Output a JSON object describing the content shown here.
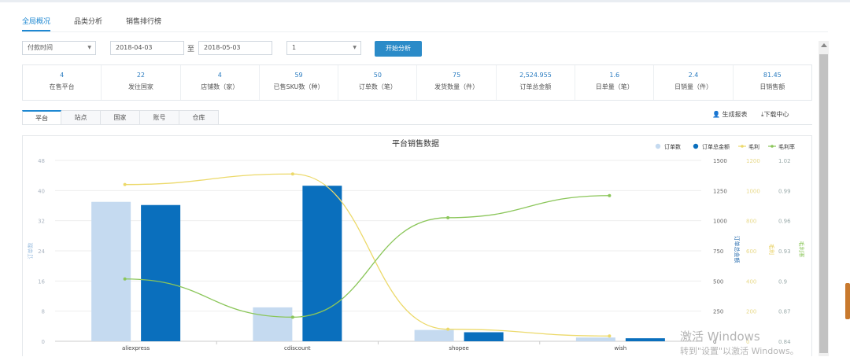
{
  "top_tabs": [
    "全局概况",
    "品类分析",
    "销售排行榜"
  ],
  "filters": {
    "time_type": "付款时间",
    "date_from": "2018-04-03",
    "to_label": "至",
    "date_to": "2018-05-03",
    "select_value": "1",
    "start_button": "开始分析"
  },
  "stats": [
    {
      "value": "4",
      "label": "在售平台"
    },
    {
      "value": "22",
      "label": "发往国家"
    },
    {
      "value": "4",
      "label": "店铺数（家）"
    },
    {
      "value": "59",
      "label": "已售SKU数（种）"
    },
    {
      "value": "50",
      "label": "订单数（笔）"
    },
    {
      "value": "75",
      "label": "发货数量（件）"
    },
    {
      "value": "2,524.955",
      "label": "订单总金额"
    },
    {
      "value": "1.6",
      "label": "日单量（笔）"
    },
    {
      "value": "2.4",
      "label": "日销量（件）"
    },
    {
      "value": "81.45",
      "label": "日销售额"
    }
  ],
  "sub_tabs": [
    "平台",
    "站点",
    "国家",
    "账号",
    "仓库"
  ],
  "actions": {
    "report": "生成报表",
    "download": "下载中心"
  },
  "colors": {
    "accent": "#1e88d2",
    "button": "#2b8bc8",
    "orders": "#c5daf0",
    "amount": "#0a6fbd",
    "profit": "#ecd96a",
    "margin": "#8bc65a"
  },
  "chart_data": {
    "type": "bar",
    "title": "平台销售数据",
    "categories": [
      "aliexpress",
      "cdiscount",
      "shopee",
      "wish"
    ],
    "series": [
      {
        "name": "订单数",
        "type": "bar",
        "axis": "left",
        "values": [
          37,
          9,
          3,
          1
        ]
      },
      {
        "name": "订单总金额",
        "type": "bar",
        "axis": "right1",
        "values": [
          1130,
          1290,
          75,
          25
        ]
      },
      {
        "name": "毛利",
        "type": "line",
        "axis": "right2",
        "values": [
          1040,
          1110,
          80,
          35
        ]
      },
      {
        "name": "毛利率",
        "type": "line",
        "axis": "right3",
        "values": [
          0.902,
          0.864,
          0.963,
          0.985
        ]
      }
    ],
    "axes": {
      "left": {
        "label": "订单数",
        "ticks": [
          "0",
          "8",
          "16",
          "24",
          "32",
          "40",
          "48"
        ],
        "min": 0,
        "max": 48
      },
      "right1": {
        "label": "订单总金额",
        "ticks": [
          "0",
          "250",
          "500",
          "750",
          "1000",
          "1250",
          "1500"
        ],
        "min": 0,
        "max": 1500
      },
      "right2": {
        "label": "毛利",
        "ticks": [
          "0",
          "200",
          "400",
          "600",
          "800",
          "1000",
          "1200"
        ],
        "min": 0,
        "max": 1200
      },
      "right3": {
        "label": "毛利率",
        "ticks": [
          "0.84",
          "0.87",
          "0.9",
          "0.93",
          "0.96",
          "0.99",
          "1.02"
        ],
        "min": 0.84,
        "max": 1.02
      }
    },
    "legend": "top-right"
  },
  "watermark": {
    "line1": "激活 Windows",
    "line2": "转到\"设置\"以激活 Windows。"
  }
}
